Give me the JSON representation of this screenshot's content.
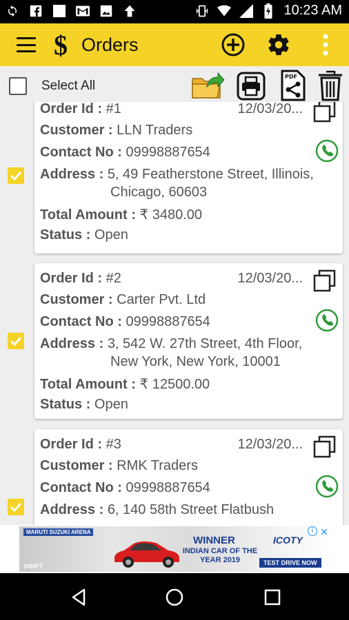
{
  "status_bar": {
    "time": "10:23 AM",
    "left_icons": [
      "sync-icon",
      "facebook-icon",
      "blank-notification-icon",
      "gmail-icon",
      "image-icon",
      "upload-icon"
    ],
    "right_icons": [
      "vibrate-icon",
      "wifi-icon",
      "signal-icon",
      "battery-icon"
    ]
  },
  "appbar": {
    "title": "Orders",
    "logo": "$",
    "actions": [
      "add-icon",
      "settings-icon",
      "more-vert-icon"
    ]
  },
  "toolbar": {
    "select_all_label": "Select All",
    "select_all_checked": false,
    "actions": [
      "export-folder-icon",
      "print-icon",
      "pdf-share-icon",
      "delete-icon"
    ]
  },
  "labels": {
    "order_id": "Order Id :",
    "customer": "Customer :",
    "contact": "Contact No :",
    "address": "Address :",
    "total": "Total Amount :",
    "status": "Status :"
  },
  "orders": [
    {
      "checked": true,
      "id": "#1",
      "date": "12/03/20...",
      "customer": "LLN Traders",
      "contact": "09998887654",
      "address_1": "5, 49 Featherstone Street, Illinois,",
      "address_2": "Chicago, 60603",
      "total": "₹ 3480.00",
      "status": "Open"
    },
    {
      "checked": true,
      "id": "#2",
      "date": "12/03/20...",
      "customer": "Carter Pvt. Ltd",
      "contact": "09998887654",
      "address_1": "3, 542 W. 27th Street, 4th Floor,",
      "address_2": "New York, New York, 10001",
      "total": "₹ 12500.00",
      "status": "Open"
    },
    {
      "checked": true,
      "id": "#3",
      "date": "12/03/20...",
      "customer": "RMK Traders",
      "contact": "09998887654",
      "address_1": "6, 140 58th Street Flatbush",
      "address_2": "",
      "total": "",
      "status": ""
    }
  ],
  "ad": {
    "brand": "MARUTI SUZUKI ARENA",
    "model": "SWIFT",
    "headline": "WINNER",
    "subline": "INDIAN CAR OF THE YEAR 2019",
    "award": "ICOTY",
    "cta": "TEST DRIVE NOW"
  },
  "nav_bar": [
    "back-icon",
    "home-icon",
    "recents-icon"
  ],
  "colors": {
    "accent": "#f5d326",
    "call_green": "#2e9b3a",
    "text": "#555555"
  }
}
